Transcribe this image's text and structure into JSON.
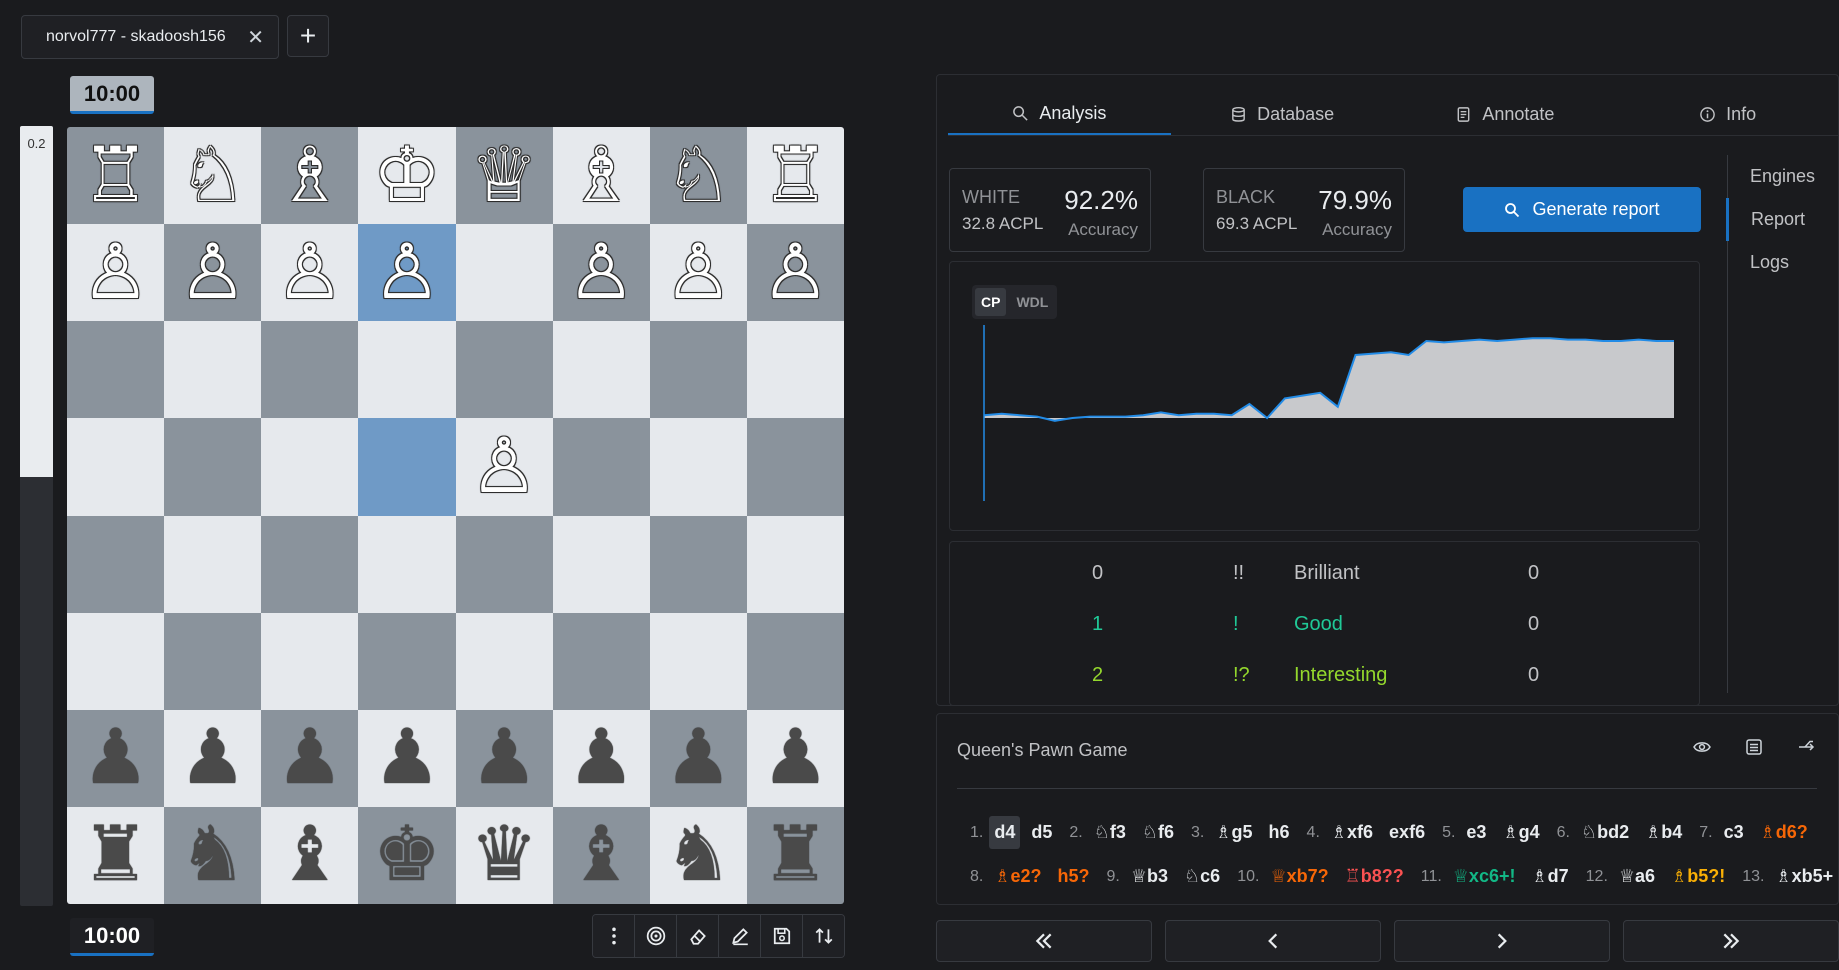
{
  "tab": {
    "label": "norvol777 - skadoosh156",
    "close_glyph": "✕",
    "add_glyph": "+"
  },
  "clocks": {
    "top": "10:00",
    "bottom": "10:00"
  },
  "eval": {
    "value": "0.2",
    "white_fraction": 0.45
  },
  "board": {
    "highlighted": [
      "e2",
      "e4"
    ],
    "pieces": {
      "h1": "♖",
      "g1": "♘",
      "f1": "♗",
      "e1": "♔",
      "d1": "♕",
      "c1": "♗",
      "b1": "♘",
      "a1": "♖",
      "h2": "♙",
      "g2": "♙",
      "f2": "♙",
      "e2": "♙",
      "c2": "♙",
      "b2": "♙",
      "a2": "♙",
      "d4": "♙",
      "h7": "♟",
      "g7": "♟",
      "f7": "♟",
      "e7": "♟",
      "d7": "♟",
      "c7": "♟",
      "b7": "♟",
      "a7": "♟",
      "h8": "♜",
      "g8": "♞",
      "f8": "♝",
      "e8": "♚",
      "d8": "♛",
      "c8": "♝",
      "b8": "♞",
      "a8": "♜"
    }
  },
  "toolbar": [
    "more-icon",
    "target-icon",
    "eraser-icon",
    "edit-icon",
    "save-icon",
    "flip-icon"
  ],
  "tabs": [
    {
      "label": "Analysis",
      "icon": "search-icon",
      "active": true
    },
    {
      "label": "Database",
      "icon": "database-icon",
      "active": false
    },
    {
      "label": "Annotate",
      "icon": "notes-icon",
      "active": false
    },
    {
      "label": "Info",
      "icon": "info-icon",
      "active": false
    }
  ],
  "report": {
    "white": {
      "label": "WHITE",
      "acpl": "32.8 ACPL",
      "pct": "92.2%",
      "acc": "Accuracy"
    },
    "black": {
      "label": "BLACK",
      "acpl": "69.3 ACPL",
      "pct": "79.9%",
      "acc": "Accuracy"
    },
    "generate": "Generate report",
    "graph_modes": [
      "CP",
      "WDL"
    ],
    "stats": [
      {
        "w": "0",
        "sym": "!!",
        "name": "Brilliant",
        "b": "0",
        "color": "#c1c2c5"
      },
      {
        "w": "1",
        "sym": "!",
        "name": "Good",
        "b": "0",
        "color": "#20c997"
      },
      {
        "w": "2",
        "sym": "!?",
        "name": "Interesting",
        "b": "0",
        "color": "#94d82d"
      }
    ],
    "eval_series": [
      0.02,
      0.03,
      0.02,
      0.01,
      -0.02,
      0.0,
      0.01,
      0.01,
      0.01,
      0.02,
      0.04,
      0.02,
      0.03,
      0.03,
      0.02,
      0.1,
      0.0,
      0.14,
      0.16,
      0.18,
      0.08,
      0.45,
      0.46,
      0.47,
      0.45,
      0.55,
      0.54,
      0.55,
      0.56,
      0.55,
      0.56,
      0.57,
      0.57,
      0.56,
      0.56,
      0.55,
      0.55,
      0.56,
      0.55,
      0.55
    ]
  },
  "side_tabs": [
    {
      "label": "Engines",
      "active": false
    },
    {
      "label": "Report",
      "active": true
    },
    {
      "label": "Logs",
      "active": false
    }
  ],
  "opening": "Queen's Pawn Game",
  "move_lines": [
    [
      {
        "n": "1."
      },
      {
        "m": "d4",
        "cls": "sel"
      },
      {
        "m": "d5"
      },
      {
        "n": "2."
      },
      {
        "m": "♘f3"
      },
      {
        "m": "♘f6"
      },
      {
        "n": "3."
      },
      {
        "m": "♗g5"
      },
      {
        "m": "h6"
      },
      {
        "n": "4."
      },
      {
        "m": "♗xf6"
      },
      {
        "m": "exf6"
      },
      {
        "n": "5."
      },
      {
        "m": "e3"
      },
      {
        "m": "♗g4"
      },
      {
        "n": "6."
      },
      {
        "m": "♘bd2"
      },
      {
        "m": "♗b4"
      },
      {
        "n": "7."
      },
      {
        "m": "c3"
      },
      {
        "m": "♗d6?",
        "cls": "mistake"
      }
    ],
    [
      {
        "n": "8."
      },
      {
        "m": "♗e2?",
        "cls": "mistake"
      },
      {
        "m": "h5?",
        "cls": "mistake"
      },
      {
        "n": "9."
      },
      {
        "m": "♕b3"
      },
      {
        "m": "♘c6"
      },
      {
        "n": "10."
      },
      {
        "m": "♕xb7?",
        "cls": "mistake"
      },
      {
        "m": "♖b8??",
        "cls": "blunder"
      },
      {
        "n": "11."
      },
      {
        "m": "♕xc6+!",
        "cls": "good"
      },
      {
        "m": "♗d7"
      },
      {
        "n": "12."
      },
      {
        "m": "♕a6"
      },
      {
        "m": "♗b5?!",
        "cls": "dubious"
      },
      {
        "n": "13."
      },
      {
        "m": "♗xb5+"
      }
    ]
  ],
  "nav": [
    "first-icon",
    "prev-icon",
    "next-icon",
    "last-icon"
  ]
}
